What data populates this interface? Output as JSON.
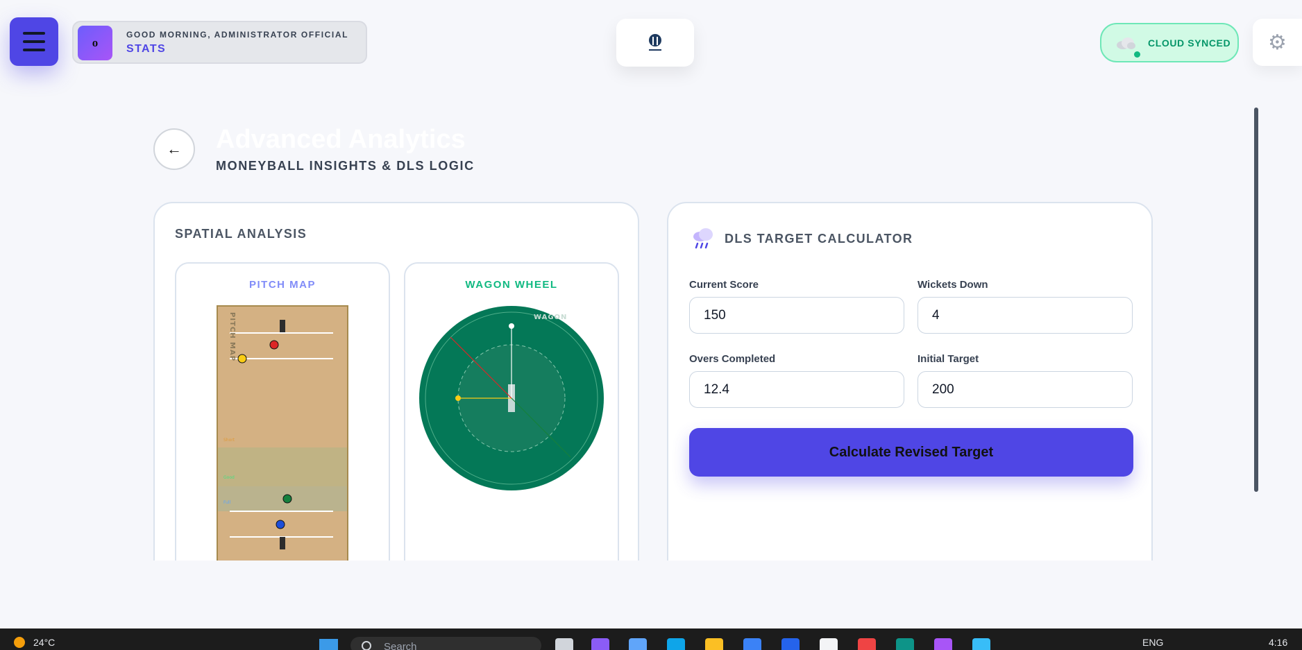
{
  "header": {
    "avatar_letter": "o",
    "greeting": "GOOD MORNING, ADMINISTRATOR OFFICIAL",
    "section": "STATS",
    "sync_status": "CLOUD SYNCED"
  },
  "page": {
    "back_glyph": "←",
    "title": "Advanced Analytics",
    "subtitle": "MONEYBALL INSIGHTS & DLS LOGIC"
  },
  "spatial": {
    "title": "SPATIAL ANALYSIS",
    "pitch_map": {
      "title": "PITCH MAP",
      "title_color": "#818cf8",
      "watermark": "PITCH MAP",
      "zones": [
        "Short",
        "Good",
        "Full"
      ],
      "balls": [
        {
          "color": "#dc2626"
        },
        {
          "color": "#facc15"
        },
        {
          "color": "#15803d"
        },
        {
          "color": "#1d4ed8"
        }
      ]
    },
    "wagon_wheel": {
      "title": "WAGON WHEEL",
      "title_color": "#10b981",
      "watermark": "WAGON"
    }
  },
  "dls": {
    "title": "DLS TARGET CALCULATOR",
    "fields": {
      "current_score": {
        "label": "Current Score",
        "value": "150"
      },
      "wickets_down": {
        "label": "Wickets Down",
        "value": "4"
      },
      "overs_completed": {
        "label": "Overs Completed",
        "value": "12.4"
      },
      "initial_target": {
        "label": "Initial Target",
        "value": "200"
      }
    },
    "button_label": "Calculate Revised Target"
  },
  "taskbar": {
    "temperature": "24°C",
    "search_placeholder": "Search",
    "language": "ENG",
    "time": "4:16 am"
  },
  "colors": {
    "accent": "#4f46e5",
    "sync_green": "#059669",
    "field_green": "#047857"
  }
}
